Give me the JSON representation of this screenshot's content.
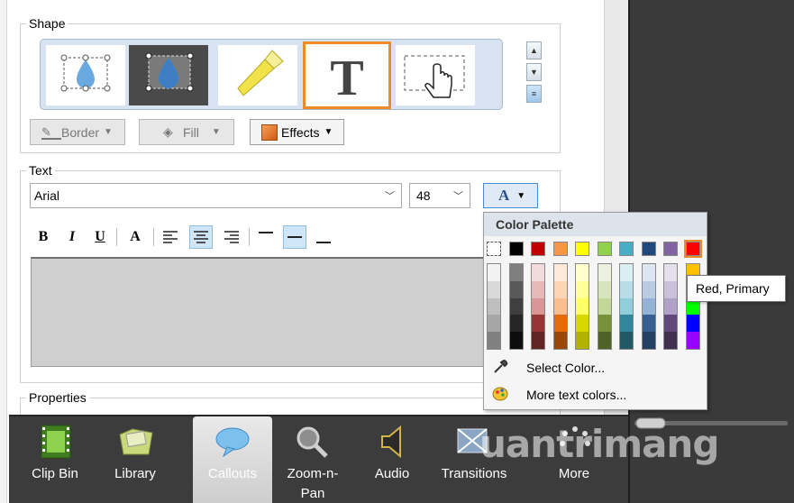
{
  "shape_section": {
    "legend": "Shape",
    "border_label": "Border",
    "fill_label": "Fill",
    "effects_label": "Effects"
  },
  "text_section": {
    "legend": "Text",
    "font_value": "Arial",
    "size_value": "48",
    "color_button_glyph": "A",
    "format_buttons": [
      "B",
      "I",
      "U",
      "A"
    ]
  },
  "properties_section": {
    "legend": "Properties"
  },
  "color_palette": {
    "title": "Color Palette",
    "primary_colors": [
      "#ffffff",
      "#000000",
      "#c00000",
      "#f79646",
      "#ffff00",
      "#92d050",
      "#4bacc6",
      "#1f497d",
      "#8064a2",
      "#ff0000"
    ],
    "select_color_label": "Select Color...",
    "more_colors_label": "More text colors...",
    "tooltip": "Red, Primary"
  },
  "tabs": [
    {
      "label": "Clip Bin",
      "icon": "film-icon"
    },
    {
      "label": "Library",
      "icon": "folder-icon"
    },
    {
      "label": "Callouts",
      "icon": "speech-bubble-icon"
    },
    {
      "label": "Zoom-n-\nPan",
      "icon": "magnifier-icon"
    },
    {
      "label": "Audio",
      "icon": "speaker-icon"
    },
    {
      "label": "Transitions",
      "icon": "transitions-icon"
    },
    {
      "label": "More",
      "icon": "dots-icon"
    }
  ],
  "watermark": "uantrimang",
  "colors": {
    "accent_selected": "#f08a24",
    "dark_panel": "#3a3a3a",
    "palette_header": "#dde3ea"
  }
}
